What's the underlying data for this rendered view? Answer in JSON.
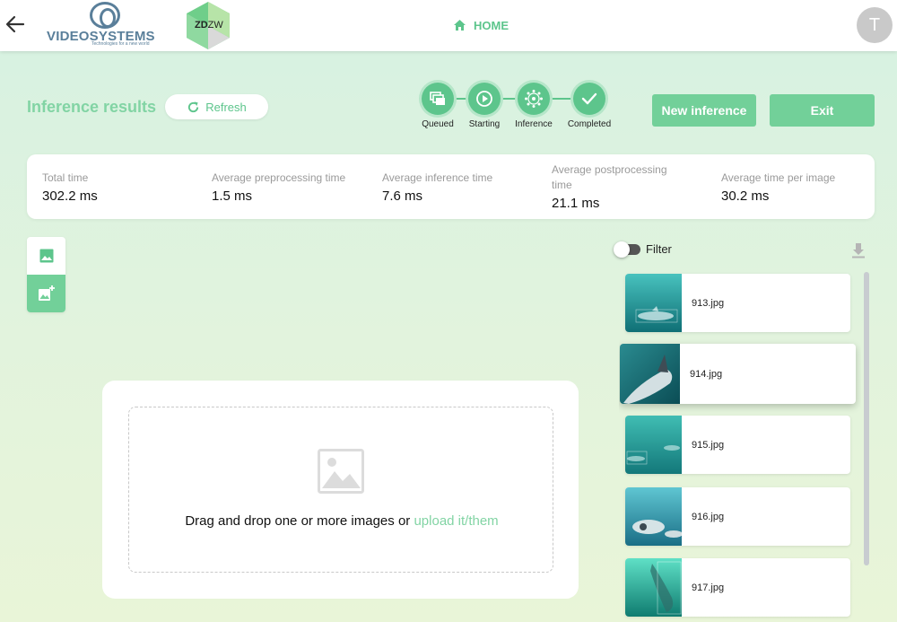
{
  "header": {
    "logo_vs_name": "VIDEOSYSTEMS",
    "logo_vs_tagline": "Technologies for a new world",
    "logo_zdzw_a": "ZD",
    "logo_zdzw_b": "ZW",
    "home_label": "HOME",
    "avatar_initial": "T"
  },
  "page": {
    "title": "Inference results",
    "refresh_label": "Refresh",
    "new_inference_label": "New inference",
    "exit_label": "Exit"
  },
  "stepper": {
    "steps": [
      {
        "label": "Queued",
        "icon": "queue-icon"
      },
      {
        "label": "Starting",
        "icon": "play-icon"
      },
      {
        "label": "Inference",
        "icon": "network-icon"
      },
      {
        "label": "Completed",
        "icon": "check-icon"
      }
    ]
  },
  "stats": [
    {
      "label": "Total time",
      "value": "302.2 ms"
    },
    {
      "label": "Average preprocessing time",
      "value": "1.5 ms"
    },
    {
      "label": "Average inference time",
      "value": "7.6 ms"
    },
    {
      "label": "Average postprocessing time",
      "value": "21.1 ms"
    },
    {
      "label": "Average time per image",
      "value": "30.2 ms"
    }
  ],
  "upload": {
    "text": "Drag and drop one or more images or ",
    "link": "upload it/them"
  },
  "filter": {
    "label": "Filter",
    "enabled": false
  },
  "images": [
    {
      "name": "913.jpg",
      "selected": false
    },
    {
      "name": "914.jpg",
      "selected": true
    },
    {
      "name": "915.jpg",
      "selected": false
    },
    {
      "name": "916.jpg",
      "selected": false
    },
    {
      "name": "917.jpg",
      "selected": false
    }
  ],
  "colors": {
    "accent": "#5dc58c",
    "accent_light": "#82d4a4",
    "button": "#72d099"
  }
}
